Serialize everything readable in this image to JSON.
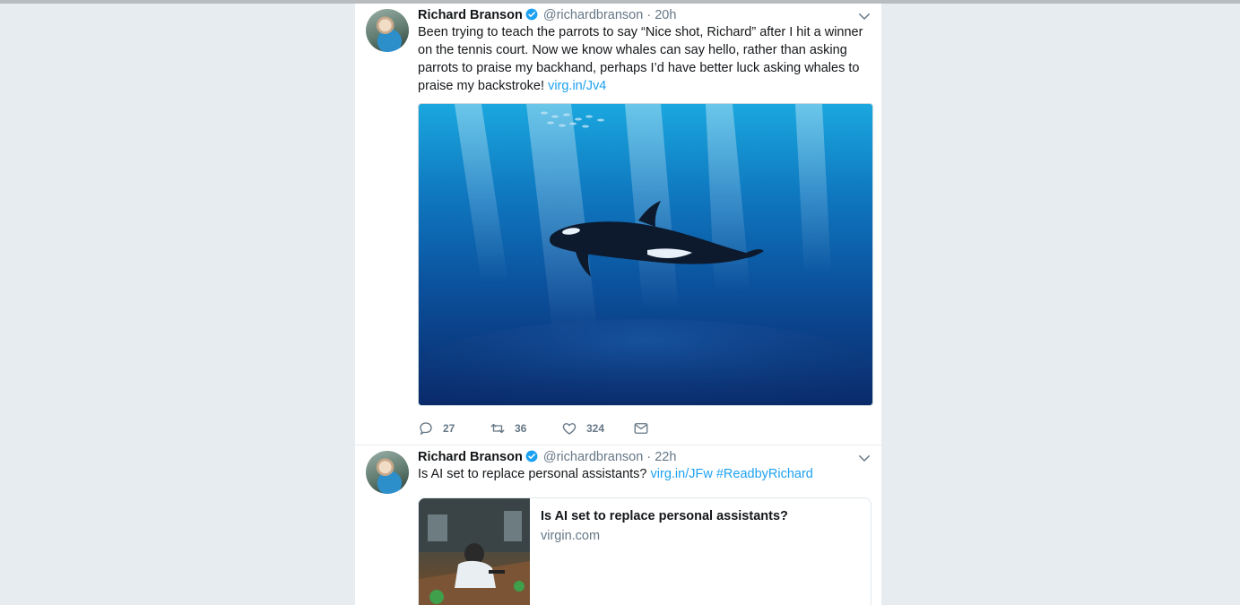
{
  "tweets": [
    {
      "author": "Richard Branson",
      "handle": "@richardbranson",
      "separator": "·",
      "time": "20h",
      "text": "Been trying to teach the parrots to say “Nice shot, Richard” after I hit a winner on the tennis court. Now we know whales can say hello, rather than asking parrots to praise my backhand, perhaps I’d have better luck asking whales to praise my backstroke! ",
      "link": "virg.in/Jv4",
      "reply_count": "27",
      "retweet_count": "36",
      "like_count": "324"
    },
    {
      "author": "Richard Branson",
      "handle": "@richardbranson",
      "separator": "·",
      "time": "22h",
      "text": "Is AI set to replace personal assistants? ",
      "link": "virg.in/JFw",
      "hashtag": "#ReadbyRichard",
      "card": {
        "title": "Is AI set to replace personal assistants?",
        "domain": "virgin.com"
      }
    }
  ],
  "colors": {
    "background": "#e6ecf0",
    "link": "#1da1f2",
    "muted": "#657786",
    "text": "#14171a"
  },
  "icons": [
    "verified-icon",
    "chevron-down-icon",
    "reply-icon",
    "retweet-icon",
    "like-icon",
    "message-icon"
  ]
}
